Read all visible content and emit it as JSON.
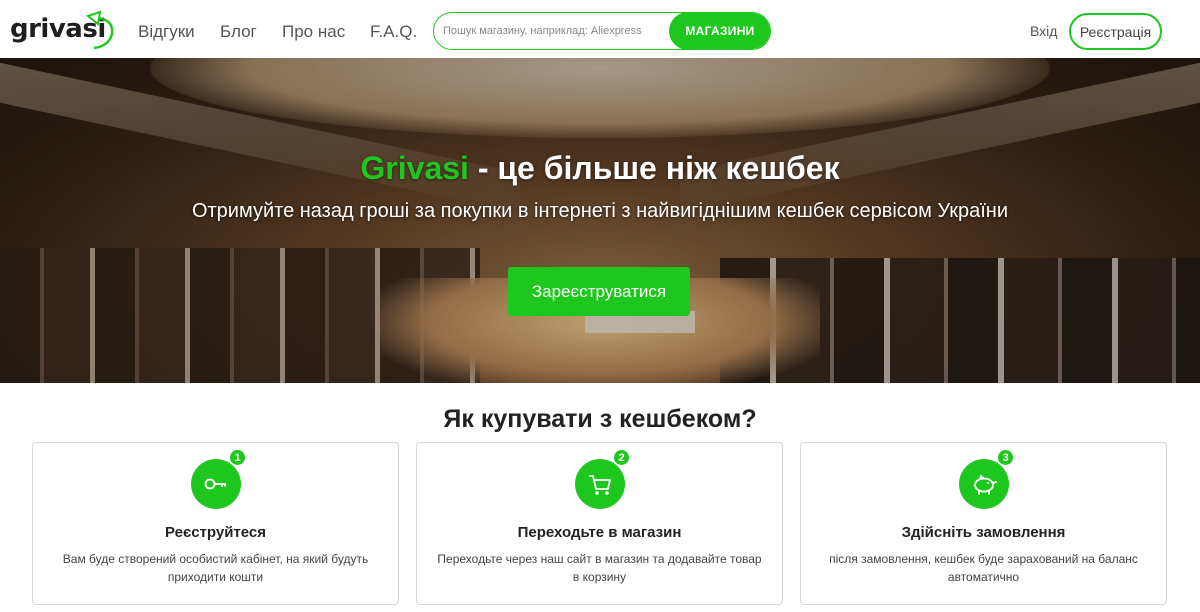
{
  "header": {
    "logo_text": "grivasi",
    "nav": [
      {
        "label": "Відгуки"
      },
      {
        "label": "Блог"
      },
      {
        "label": "Про нас"
      },
      {
        "label": "F.A.Q."
      }
    ],
    "search": {
      "placeholder": "Пошук магазину, наприклад: Aliexpress",
      "button_label": "МАГАЗИНИ"
    },
    "login_label": "Вхід",
    "register_label": "Реєстрація"
  },
  "hero": {
    "title_brand": "Grivasi",
    "title_rest": " - це більше ніж кешбек",
    "subtitle": "Отримуйте назад гроші за покупки в інтернеті з найвигіднішим кешбек сервісом України",
    "cta_label": "Зареєструватися"
  },
  "steps": {
    "title": "Як купувати з кешбеком?",
    "items": [
      {
        "number": "1",
        "icon": "key-icon",
        "title": "Реєструйтеся",
        "text": "Вам буде створений особистий кабінет, на який будуть приходити кошти"
      },
      {
        "number": "2",
        "icon": "cart-icon",
        "title": "Переходьте в магазин",
        "text": "Переходьте через наш сайт в магазин та додавайте товар в корзину"
      },
      {
        "number": "3",
        "icon": "piggy-bank-icon",
        "title": "Здійсніть замовлення",
        "text": "після замовлення, кешбек буде зарахований на баланс автоматично"
      }
    ]
  },
  "colors": {
    "accent": "#1ec71e",
    "text": "#222222"
  }
}
